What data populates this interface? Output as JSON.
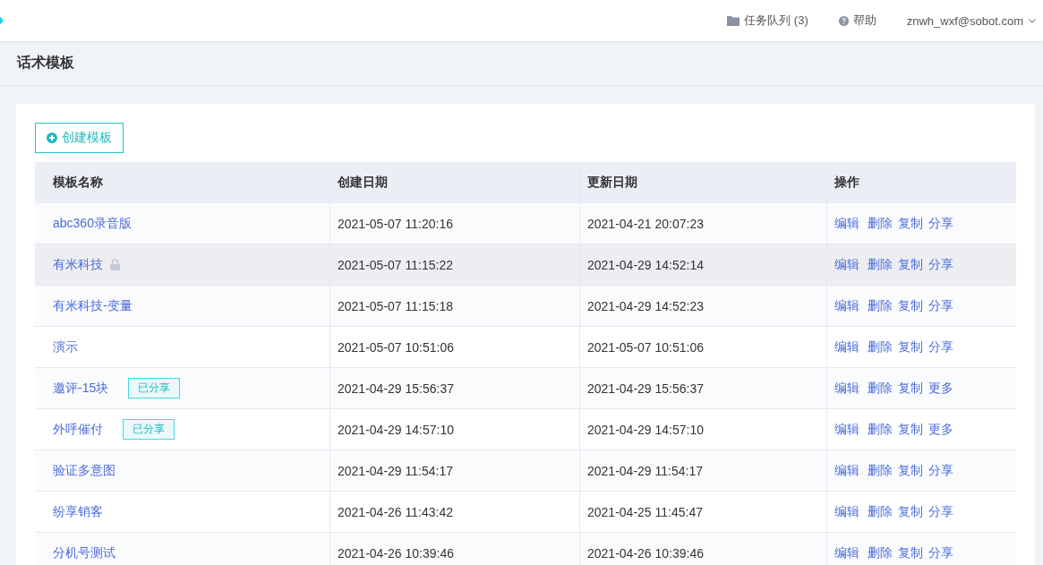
{
  "topbar": {
    "task_queue": "任务队列 (3)",
    "help": "帮助",
    "user": "znwh_wxf@sobot.com"
  },
  "page_title": "话术模板",
  "create_button": "创建模板",
  "table": {
    "columns": [
      "模板名称",
      "创建日期",
      "更新日期",
      "操作"
    ],
    "rows": [
      {
        "name": "abc360录音版",
        "locked": false,
        "created": "2021-05-07 11:20:16",
        "updated": "2021-04-21 20:07:23",
        "actions": [
          "编辑",
          "删除",
          "复制",
          "分享"
        ],
        "highlighted": false
      },
      {
        "name": "有米科技",
        "locked": true,
        "created": "2021-05-07 11:15:22",
        "updated": "2021-04-29 14:52:14",
        "actions": [
          "编辑",
          "删除",
          "复制",
          "分享"
        ],
        "highlighted": true
      },
      {
        "name": "有米科技-变量",
        "locked": false,
        "created": "2021-05-07 11:15:18",
        "updated": "2021-04-29 14:52:23",
        "actions": [
          "编辑",
          "删除",
          "复制",
          "分享"
        ],
        "highlighted": false
      },
      {
        "name": "演示",
        "locked": false,
        "created": "2021-05-07 10:51:06",
        "updated": "2021-05-07 10:51:06",
        "actions": [
          "编辑",
          "删除",
          "复制",
          "分享"
        ],
        "highlighted": false
      },
      {
        "name": "邀评-15块",
        "locked": false,
        "tag": "已分享",
        "created": "2021-04-29 15:56:37",
        "updated": "2021-04-29 15:56:37",
        "actions": [
          "编辑",
          "删除",
          "复制",
          "更多"
        ],
        "highlighted": false
      },
      {
        "name": "外呼催付",
        "locked": false,
        "tag": "已分享",
        "created": "2021-04-29 14:57:10",
        "updated": "2021-04-29 14:57:10",
        "actions": [
          "编辑",
          "删除",
          "复制",
          "更多"
        ],
        "highlighted": false
      },
      {
        "name": "验证多意图",
        "locked": false,
        "created": "2021-04-29 11:54:17",
        "updated": "2021-04-29 11:54:17",
        "actions": [
          "编辑",
          "删除",
          "复制",
          "分享"
        ],
        "highlighted": false
      },
      {
        "name": "纷享销客",
        "locked": false,
        "created": "2021-04-26 11:43:42",
        "updated": "2021-04-25 11:45:47",
        "actions": [
          "编辑",
          "删除",
          "复制",
          "分享"
        ],
        "highlighted": false
      },
      {
        "name": "分机号测试",
        "locked": false,
        "created": "2021-04-26 10:39:46",
        "updated": "2021-04-26 10:39:46",
        "actions": [
          "编辑",
          "删除",
          "复制",
          "分享"
        ],
        "highlighted": false
      }
    ]
  }
}
